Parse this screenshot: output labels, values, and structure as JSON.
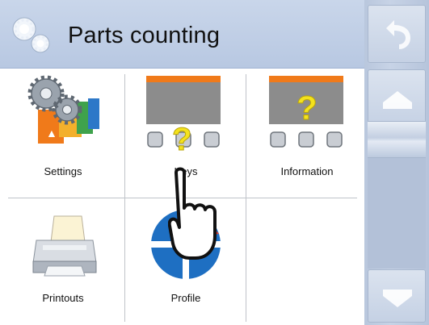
{
  "header": {
    "title": "Parts counting",
    "icon": "gears-icon"
  },
  "tiles": [
    {
      "label": "Settings",
      "icon": "settings-gears-icon"
    },
    {
      "label": "Keys",
      "icon": "keys-help-icon"
    },
    {
      "label": "Information",
      "icon": "information-help-icon"
    },
    {
      "label": "Printouts",
      "icon": "printer-icon"
    },
    {
      "label": "Profile",
      "icon": "profile-icon"
    }
  ],
  "sidebar": {
    "back_icon": "undo-arrow-icon",
    "up_icon": "arrow-up-icon",
    "down_icon": "arrow-down-icon"
  },
  "colors": {
    "header_bg": "#c4d2e8",
    "accent_orange": "#f07a1a",
    "help_yellow": "#f4e21c",
    "profile_blue": "#1e6fc2"
  }
}
